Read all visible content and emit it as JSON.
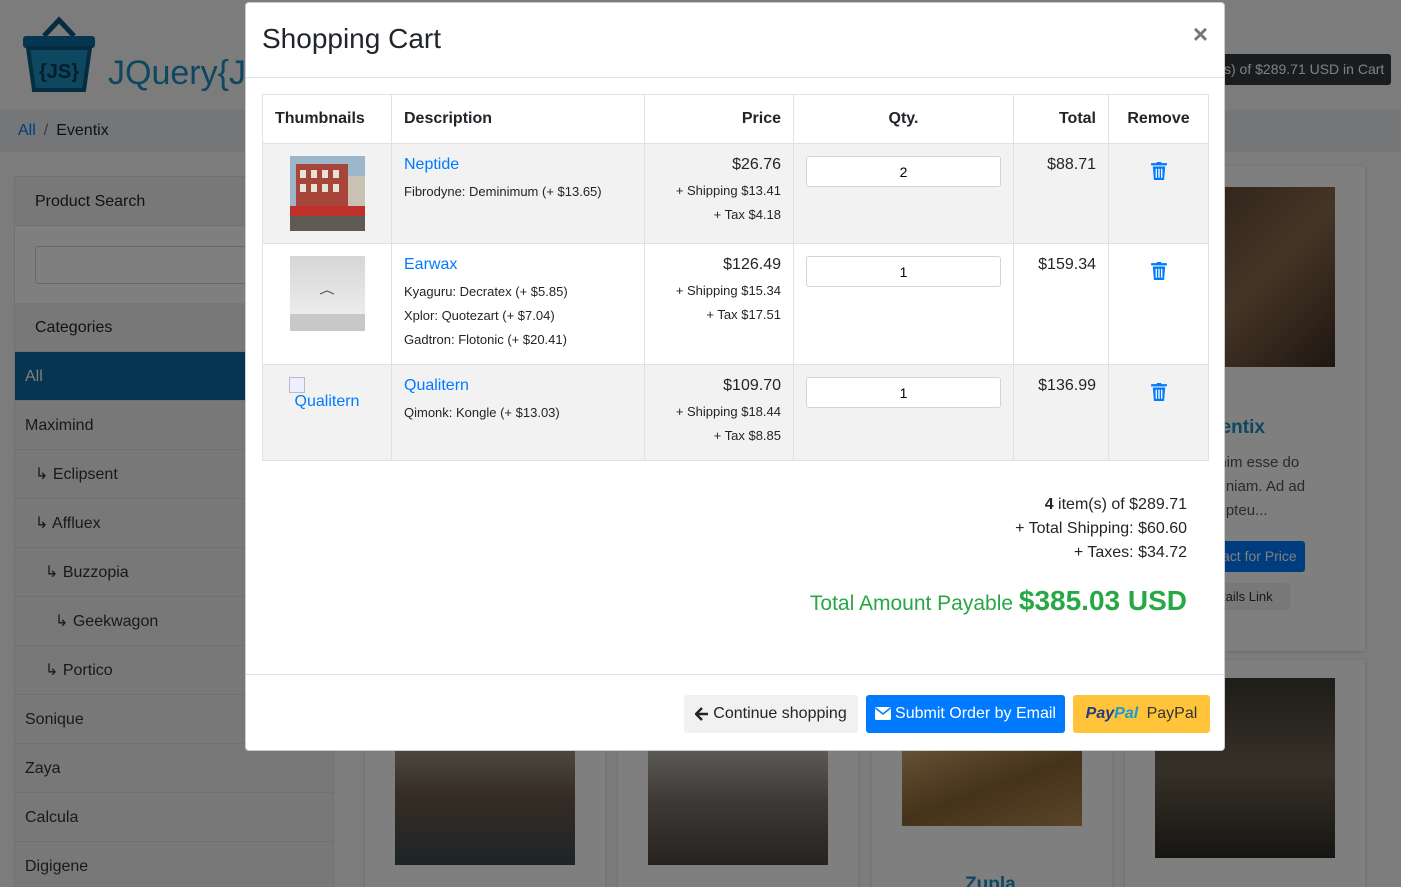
{
  "header": {
    "logo_text": "JQuery{JS",
    "cart_summary": "s) of $289.71 USD in Cart"
  },
  "breadcrumb": {
    "items": [
      "All",
      "Eventix"
    ]
  },
  "sidebar": {
    "search_title": "Product Search",
    "categories_title": "Categories",
    "categories": [
      "All",
      "Maximind",
      "↳ Eclipsent",
      "↳ Affluex",
      "↳ Buzzopia",
      "↳ Geekwagon",
      "↳ Portico",
      "Sonique",
      "Zaya",
      "Calcula",
      "Digigene"
    ]
  },
  "background_products": {
    "title_fragment": "ventix",
    "desc_fragment": [
      "enim esse do",
      "veniam. Ad ad",
      "cepteu..."
    ],
    "contact_button": "act for Price",
    "details_link": "tails Link",
    "next_title_fragment": "Zupla"
  },
  "modal": {
    "title": "Shopping Cart",
    "close_label": "×",
    "columns": [
      "Thumbnails",
      "Description",
      "Price",
      "Qty.",
      "Total",
      "Remove"
    ],
    "items": [
      {
        "name": "Neptide",
        "options": [
          "Fibrodyne: Deminimum (+ $13.65)"
        ],
        "price": "$26.76",
        "shipping": "+ Shipping $13.41",
        "tax": "+ Tax $4.18",
        "qty": "2",
        "total": "$88.71",
        "thumb": "street-photo"
      },
      {
        "name": "Earwax",
        "options": [
          "Kyaguru: Decratex (+ $5.85)",
          "Xplor: Quotezart (+ $7.04)",
          "Gadtron: Flotonic (+ $20.41)"
        ],
        "price": "$126.49",
        "shipping": "+ Shipping $15.34",
        "tax": "+ Tax $17.51",
        "qty": "1",
        "total": "$159.34",
        "thumb": "bird-sky-photo"
      },
      {
        "name": "Qualitern",
        "options": [
          "Qimonk: Kongle (+ $13.03)"
        ],
        "price": "$109.70",
        "shipping": "+ Shipping $18.44",
        "tax": "+ Tax $8.85",
        "qty": "1",
        "total": "$136.99",
        "thumb": "broken-image",
        "thumb_alt": "Qualitern"
      }
    ],
    "summary": {
      "item_count": "4",
      "items_text": " item(s) of $289.71",
      "shipping": "+ Total Shipping: $60.60",
      "taxes": "+ Taxes: $34.72",
      "grand_label": "Total Amount Payable ",
      "grand_amount": "$385.03 USD"
    },
    "footer": {
      "continue_label": "Continue shopping",
      "email_label": "Submit Order by Email",
      "paypal_logo_pay": "Pay",
      "paypal_logo_pal": "Pal",
      "paypal_label": "PayPal"
    }
  },
  "colors": {
    "link": "#007bff",
    "grand_total": "#28a745",
    "paypal": "#ffc439",
    "category_active": "#0b6aa2"
  }
}
